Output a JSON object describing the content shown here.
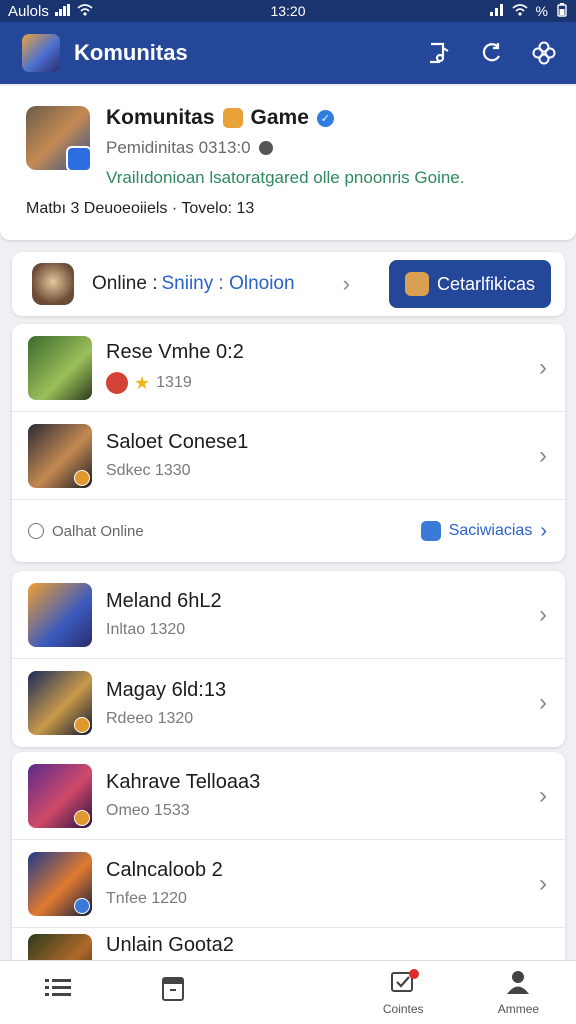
{
  "status_bar": {
    "carrier": "Aulols",
    "time": "13:20",
    "battery": "%"
  },
  "app_bar": {
    "title": "Komunitas",
    "icons": [
      "music-note-icon",
      "refresh-icon",
      "settings-flower-icon"
    ]
  },
  "profile": {
    "title": "Komunitas",
    "title_suffix": "Game",
    "subtitle": "Pemidinitas 0313:0",
    "description": "Vrailıdonioan lsatoratgared olle pnoonris Goine.",
    "stats": "Matbı 3   Deuoeoiiels · Tovelo: 13"
  },
  "online": {
    "label": "Online :",
    "value": "Sniiny : Olnoion",
    "cta": "Cetarlfikicas"
  },
  "list1": [
    {
      "title": "Rese Vmhe 0:2",
      "sub": "1319",
      "has_badges": true,
      "colors": [
        "#3b6a2c",
        "#9bbf5a"
      ]
    },
    {
      "title": "Saloet Conese1",
      "sub": "Sdkec 1330",
      "has_badges": false,
      "colors": [
        "#2b2a36",
        "#c48a52"
      ]
    }
  ],
  "footer_row": {
    "left": "Oalhat Online",
    "right": "Saciwiacias"
  },
  "list2": [
    {
      "title": "Meland 6hL2",
      "sub": "Inltao 1320",
      "colors": [
        "#f0a030",
        "#3b5bbf"
      ]
    },
    {
      "title": "Magay 6ld:13",
      "sub": "Rdeeo 1320",
      "colors": [
        "#1b2a5a",
        "#c89a4a"
      ]
    }
  ],
  "list3": [
    {
      "title": "Kahrave Telloaa3",
      "sub": "Omeo 1533",
      "colors": [
        "#5a2a8a",
        "#d04a6a"
      ]
    },
    {
      "title": "Calncaloob 2",
      "sub": "Tnfee 1220",
      "colors": [
        "#1f3b8a",
        "#e07a30"
      ]
    },
    {
      "title": "Unlain Goota2",
      "sub": "",
      "colors": [
        "#2b3a1a",
        "#b06a2a"
      ]
    }
  ],
  "bottom_nav": [
    {
      "name": "nav-list",
      "label": ""
    },
    {
      "name": "nav-document",
      "label": ""
    },
    {
      "name": "nav-comments",
      "label": "Cointes"
    },
    {
      "name": "nav-profile",
      "label": "Ammee"
    }
  ]
}
